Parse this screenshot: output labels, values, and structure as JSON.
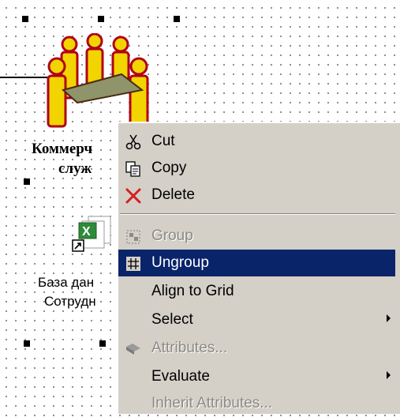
{
  "diagram": {
    "node1_label_line1": "Коммерч",
    "node1_label_line2": "служ",
    "node2_label_line1": "База дан",
    "node2_label_line2": "Сотрудн"
  },
  "context_menu": {
    "items": [
      {
        "label": "Cut",
        "icon": "scissors-icon",
        "enabled": true
      },
      {
        "label": "Copy",
        "icon": "copy-icon",
        "enabled": true
      },
      {
        "label": "Delete",
        "icon": "delete-x-icon",
        "enabled": true
      },
      {
        "label": "Group",
        "icon": "group-icon",
        "enabled": false
      },
      {
        "label": "Ungroup",
        "icon": "ungroup-icon",
        "enabled": true,
        "highlighted": true
      },
      {
        "label": "Align to Grid",
        "enabled": true
      },
      {
        "label": "Select",
        "enabled": true,
        "submenu": true
      },
      {
        "label": "Attributes...",
        "icon": "attributes-icon",
        "enabled": false
      },
      {
        "label": "Evaluate",
        "enabled": true,
        "submenu": true
      },
      {
        "label": "Inherit Attributes...",
        "enabled": false
      }
    ]
  },
  "colors": {
    "menu_bg": "#d4d0c8",
    "highlight": "#0a246a",
    "person_fill": "#f2d400",
    "person_outline": "#b0001a"
  }
}
